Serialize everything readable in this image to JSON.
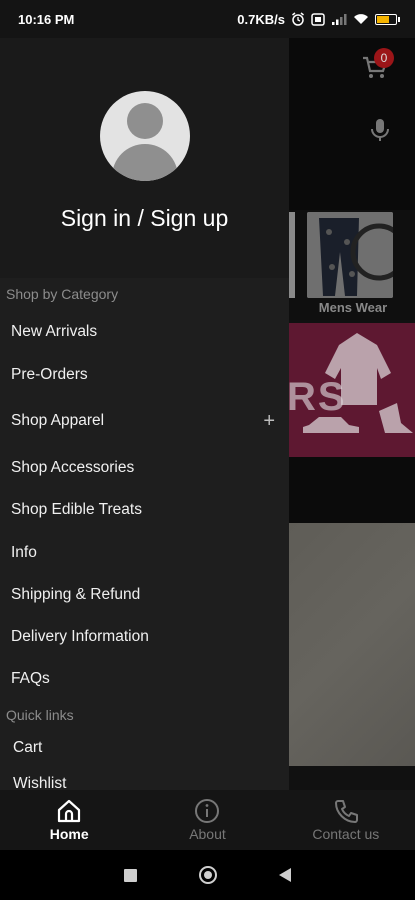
{
  "status_bar": {
    "time": "10:16 PM",
    "net_speed": "0.7KB/s",
    "battery_color": "#f5b400"
  },
  "background": {
    "cart_badge": "0",
    "category_label": "Mens Wear",
    "banner_text": "RS"
  },
  "drawer": {
    "signin_label": "Sign in / Sign up",
    "shop_section_label": "Shop by Category",
    "items": [
      {
        "label": "New Arrivals"
      },
      {
        "label": "Pre-Orders"
      },
      {
        "label": "Shop Apparel",
        "expand_icon": "+"
      },
      {
        "label": "Shop Accessories"
      },
      {
        "label": "Shop Edible Treats"
      },
      {
        "label": "Info"
      },
      {
        "label": "Shipping & Refund"
      },
      {
        "label": "Delivery Information"
      },
      {
        "label": "FAQs"
      }
    ],
    "quick_links_label": "Quick links",
    "quick_links": [
      {
        "label": "Cart"
      },
      {
        "label": "Wishlist"
      }
    ]
  },
  "bottom_nav": {
    "tabs": [
      {
        "label": "Home",
        "icon": "home-icon",
        "active": true
      },
      {
        "label": "About",
        "icon": "info-icon",
        "active": false
      },
      {
        "label": "Contact us",
        "icon": "phone-icon",
        "active": false
      }
    ]
  },
  "colors": {
    "drawer_bg": "#1e1e1e",
    "accent_badge": "#9b1518",
    "banner": "#5e1831"
  }
}
